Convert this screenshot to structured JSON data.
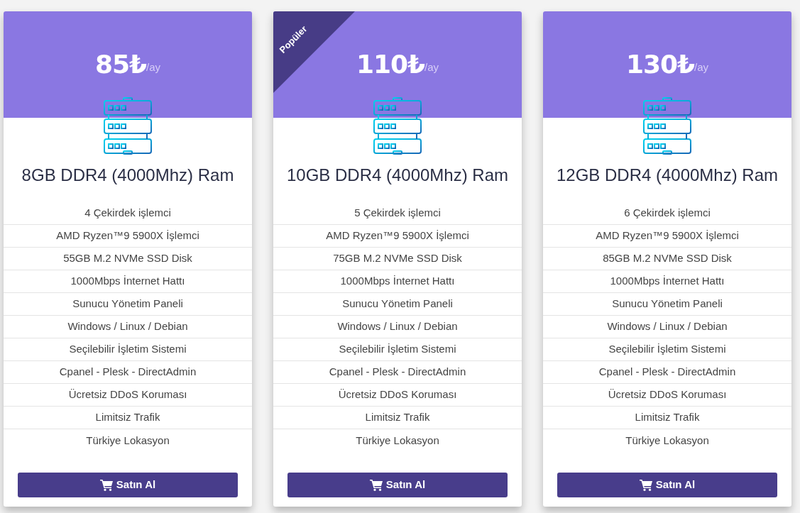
{
  "plans": [
    {
      "price": "85₺",
      "period": "/ay",
      "title": "8GB DDR4 (4000Mhz) Ram",
      "features": [
        "4 Çekirdek işlemci",
        "AMD Ryzen™9 5900X İşlemci",
        "55GB M.2 NVMe SSD Disk",
        "1000Mbps İnternet Hattı",
        "Sunucu Yönetim Paneli",
        "Windows / Linux / Debian",
        "Seçilebilir İşletim Sistemi",
        "Cpanel - Plesk - DirectAdmin",
        "Ücretsiz DDoS Koruması",
        "Limitsiz Trafik",
        "Türkiye Lokasyon"
      ],
      "button": "Satın Al"
    },
    {
      "ribbon": "Popüler",
      "price": "110₺",
      "period": "/ay",
      "title": "10GB DDR4 (4000Mhz) Ram",
      "features": [
        "5 Çekirdek işlemci",
        "AMD Ryzen™9 5900X İşlemci",
        "75GB M.2 NVMe SSD Disk",
        "1000Mbps İnternet Hattı",
        "Sunucu Yönetim Paneli",
        "Windows / Linux / Debian",
        "Seçilebilir İşletim Sistemi",
        "Cpanel - Plesk - DirectAdmin",
        "Ücretsiz DDoS Koruması",
        "Limitsiz Trafik",
        "Türkiye Lokasyon"
      ],
      "button": "Satın Al"
    },
    {
      "price": "130₺",
      "period": "/ay",
      "title": "12GB DDR4 (4000Mhz) Ram",
      "features": [
        "6 Çekirdek işlemci",
        "AMD Ryzen™9 5900X İşlemci",
        "85GB M.2 NVMe SSD Disk",
        "1000Mbps İnternet Hattı",
        "Sunucu Yönetim Paneli",
        "Windows / Linux / Debian",
        "Seçilebilir İşletim Sistemi",
        "Cpanel - Plesk - DirectAdmin",
        "Ücretsiz DDoS Koruması",
        "Limitsiz Trafik",
        "Türkiye Lokasyon"
      ],
      "button": "Satın Al"
    }
  ]
}
